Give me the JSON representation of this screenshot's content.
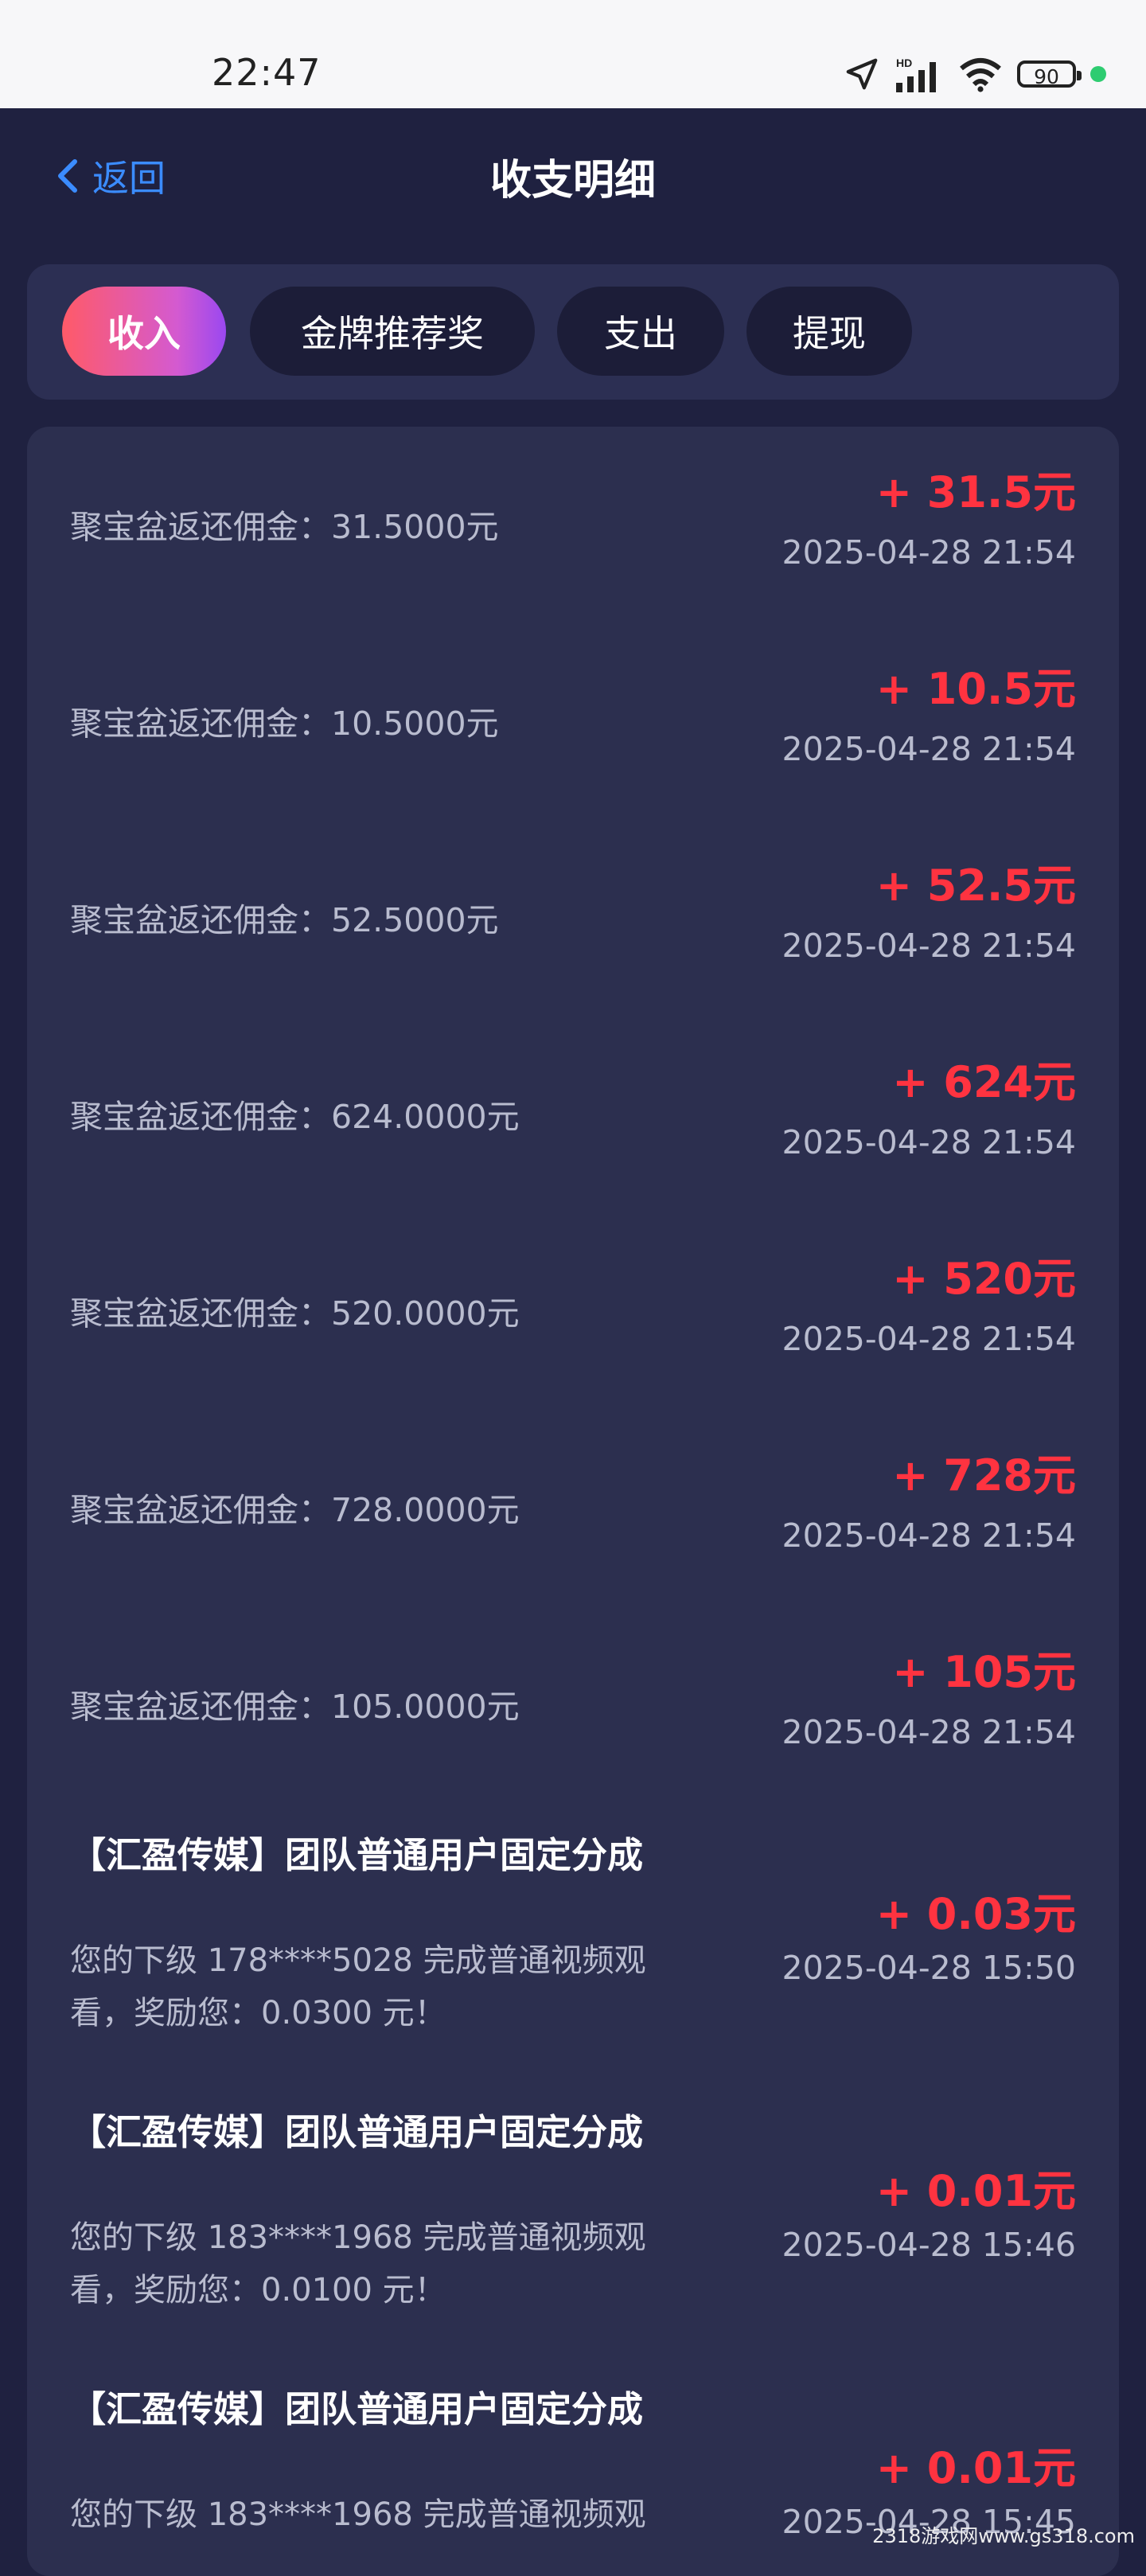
{
  "status_bar": {
    "time": "22:47",
    "battery": "90",
    "network_badge": "HD"
  },
  "header": {
    "back_label": "返回",
    "title": "收支明细"
  },
  "tabs": [
    {
      "label": "收入",
      "active": true
    },
    {
      "label": "金牌推荐奖",
      "active": false
    },
    {
      "label": "支出",
      "active": false
    },
    {
      "label": "提现",
      "active": false
    }
  ],
  "records": [
    {
      "desc": "聚宝盆返还佣金：31.5000元",
      "amount": "+ 31.5元",
      "time": "2025-04-28 21:54"
    },
    {
      "desc": "聚宝盆返还佣金：10.5000元",
      "amount": "+ 10.5元",
      "time": "2025-04-28 21:54"
    },
    {
      "desc": "聚宝盆返还佣金：52.5000元",
      "amount": "+ 52.5元",
      "time": "2025-04-28 21:54"
    },
    {
      "desc": "聚宝盆返还佣金：624.0000元",
      "amount": "+ 624元",
      "time": "2025-04-28 21:54"
    },
    {
      "desc": "聚宝盆返还佣金：520.0000元",
      "amount": "+ 520元",
      "time": "2025-04-28 21:54"
    },
    {
      "desc": "聚宝盆返还佣金：728.0000元",
      "amount": "+ 728元",
      "time": "2025-04-28 21:54"
    },
    {
      "desc": "聚宝盆返还佣金：105.0000元",
      "amount": "+ 105元",
      "time": "2025-04-28 21:54"
    }
  ],
  "team_records": [
    {
      "title": "【汇盈传媒】团队普通用户固定分成",
      "sub": "您的下级 178****5028 完成普通视频观看，奖励您：0.0300 元！",
      "amount": "+ 0.03元",
      "time": "2025-04-28 15:50"
    },
    {
      "title": "【汇盈传媒】团队普通用户固定分成",
      "sub": "您的下级 183****1968 完成普通视频观看，奖励您：0.0100 元！",
      "amount": "+ 0.01元",
      "time": "2025-04-28 15:46"
    },
    {
      "title": "【汇盈传媒】团队普通用户固定分成",
      "sub": "您的下级 183****1968 完成普通视频观",
      "amount": "+ 0.01元",
      "time": "2025-04-28 15:45"
    }
  ],
  "watermark": "2318游戏网www.gs318.com"
}
